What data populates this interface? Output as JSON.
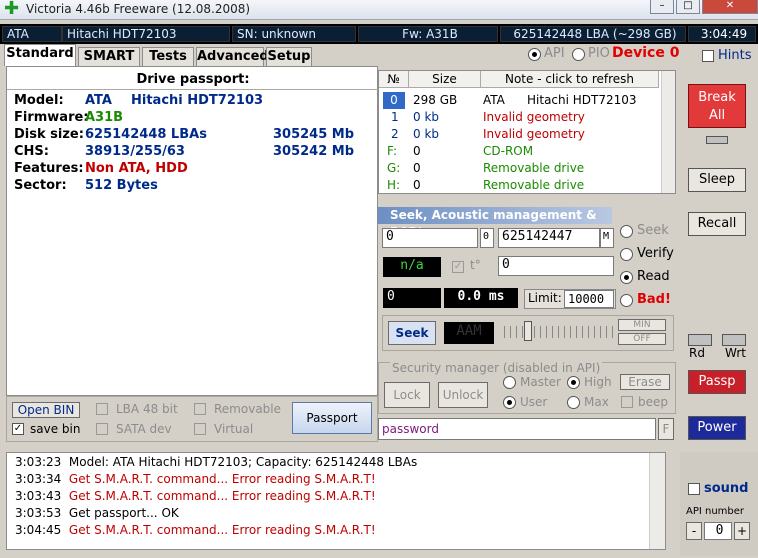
{
  "window": {
    "title": "Victoria 4.46b Freeware (12.08.2008)",
    "minimize": "–",
    "maximize": "□",
    "close": "✕"
  },
  "status": {
    "bus": "ATA",
    "model": "Hitachi HDT72103",
    "sn": "SN: unknown",
    "fw": "Fw: A31B",
    "lba": "625142448 LBA (~298 GB)",
    "time": "3:04:49"
  },
  "tabs": [
    "Standard",
    "SMART",
    "Tests",
    "Advanced",
    "Setup"
  ],
  "api": {
    "api_label": "API",
    "pio_label": "PIO",
    "device_label": "Device 0",
    "hints_label": "Hints"
  },
  "passport": {
    "title": "Drive passport:",
    "rows": [
      {
        "label": "Model:",
        "v1": "ATA",
        "v2": "Hitachi HDT72103",
        "v3": ""
      },
      {
        "label": "Firmware:",
        "v1": "A31B",
        "v2": "",
        "v3": ""
      },
      {
        "label": "Disk size:",
        "v1": "625142448 LBAs",
        "v2": "",
        "v3": "305245 Mb"
      },
      {
        "label": "CHS:",
        "v1": "38913/255/63",
        "v2": "",
        "v3": "305242 Mb"
      },
      {
        "label": "Features:",
        "v1": "Non ATA, HDD",
        "v2": "",
        "v3": ""
      },
      {
        "label": "Sector:",
        "v1": "512 Bytes",
        "v2": "",
        "v3": ""
      }
    ]
  },
  "drivelist": {
    "headers": [
      "№",
      "Size",
      "Note - click to refresh"
    ],
    "rows": [
      {
        "n": "0",
        "size": "298 GB",
        "note1": "ATA",
        "note2": "Hitachi HDT72103",
        "kind": "sel"
      },
      {
        "n": "1",
        "size": "0 kb",
        "note1": "Invalid geometry",
        "note2": "",
        "kind": "red"
      },
      {
        "n": "2",
        "size": "0 kb",
        "note1": "Invalid geometry",
        "note2": "",
        "kind": "red"
      },
      {
        "n": "F:",
        "size": "0",
        "note1": "CD-ROM",
        "note2": "",
        "kind": "green"
      },
      {
        "n": "G:",
        "size": "0",
        "note1": "Removable drive",
        "note2": "",
        "kind": "green"
      },
      {
        "n": "H:",
        "size": "0",
        "note1": "Removable drive",
        "note2": "",
        "kind": "green"
      }
    ]
  },
  "seek": {
    "title": "Seek, Acoustic management & BAD'er",
    "start": "0",
    "start_suffix": "0",
    "end": "625142447",
    "end_suffix": "M",
    "na": "n/a",
    "temp_label": "t°",
    "field": "0",
    "pos": "0",
    "speed": "0.0 ms",
    "limit_label": "Limit:",
    "limit": "10000",
    "seek_btn": "Seek",
    "aam": "AAM",
    "min": "MIN",
    "off": "OFF",
    "options": [
      "Seek",
      "Verify",
      "Read",
      "Bad!"
    ]
  },
  "security": {
    "title": "Security manager (disabled in API)",
    "lock": "Lock",
    "unlock": "Unlock",
    "erase": "Erase",
    "master": "Master",
    "high": "High",
    "user": "User",
    "max": "Max",
    "beep": "beep",
    "password": "password",
    "f": "F"
  },
  "bin": {
    "open": "Open BIN",
    "save": "save bin",
    "lba48": "LBA 48 bit",
    "removable": "Removable",
    "sata": "SATA dev",
    "virtual": "Virtual",
    "passport_btn": "Passport"
  },
  "right": {
    "break": "Break\nAll",
    "sleep": "Sleep",
    "recall": "Recall",
    "rd": "Rd",
    "wrt": "Wrt",
    "passp": "Passp",
    "power": "Power",
    "sound": "sound",
    "api_number": "API number",
    "api_value": "0",
    "minus": "-",
    "plus": "+"
  },
  "log": [
    {
      "time": "3:03:23",
      "text": "Model: ATA     Hitachi HDT72103; Capacity: 625142448 LBAs",
      "kind": "normal"
    },
    {
      "time": "3:03:34",
      "text": "Get S.M.A.R.T. command... Error reading S.M.A.R.T!",
      "kind": "red"
    },
    {
      "time": "3:03:43",
      "text": "Get S.M.A.R.T. command... Error reading S.M.A.R.T!",
      "kind": "red"
    },
    {
      "time": "3:03:53",
      "text": "Get passport... OK",
      "kind": "normal"
    },
    {
      "time": "3:04:45",
      "text": "Get S.M.A.R.T. command... Error reading S.M.A.R.T!",
      "kind": "red"
    }
  ]
}
